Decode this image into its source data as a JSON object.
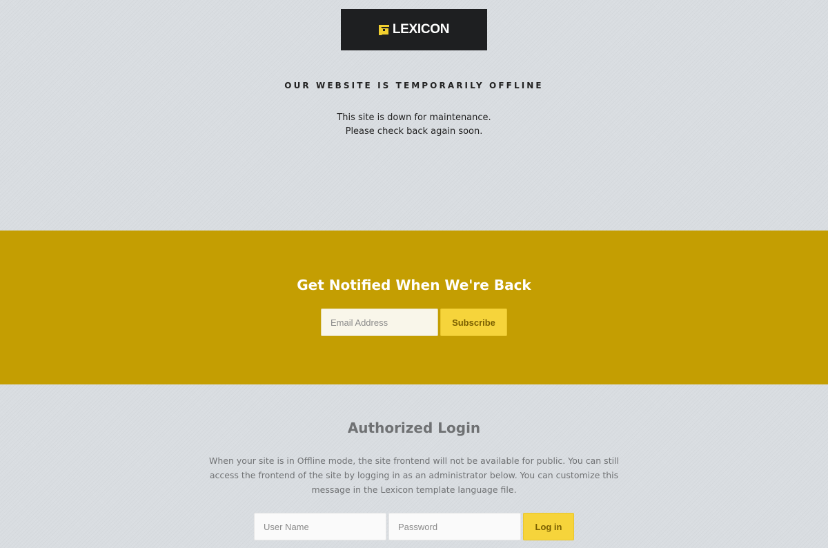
{
  "brand": {
    "logo_text": "LEXICON",
    "logo_icon": "lexicon-logo-icon",
    "accent_color": "#f1cf2f"
  },
  "offline": {
    "title": "OUR WEBSITE IS TEMPORARILY OFFLINE",
    "message_line1": "This site is down for maintenance.",
    "message_line2": "Please check back again soon."
  },
  "notify": {
    "title": "Get Notified When We're Back",
    "email_placeholder": "Email Address",
    "email_value": "",
    "subscribe_label": "Subscribe",
    "band_color": "#c49e02",
    "button_color": "#f6d43b"
  },
  "login": {
    "title": "Authorized Login",
    "description_line1": "When your site is in Offline mode, the site frontend will not be available for public. You can still",
    "description_line2": "access the frontend of the site by logging in as an administrator below. You can customize this",
    "description_line3": "message in the Lexicon template language file.",
    "username_placeholder": "User Name",
    "username_value": "",
    "password_placeholder": "Password",
    "password_value": "",
    "login_label": "Log in"
  }
}
